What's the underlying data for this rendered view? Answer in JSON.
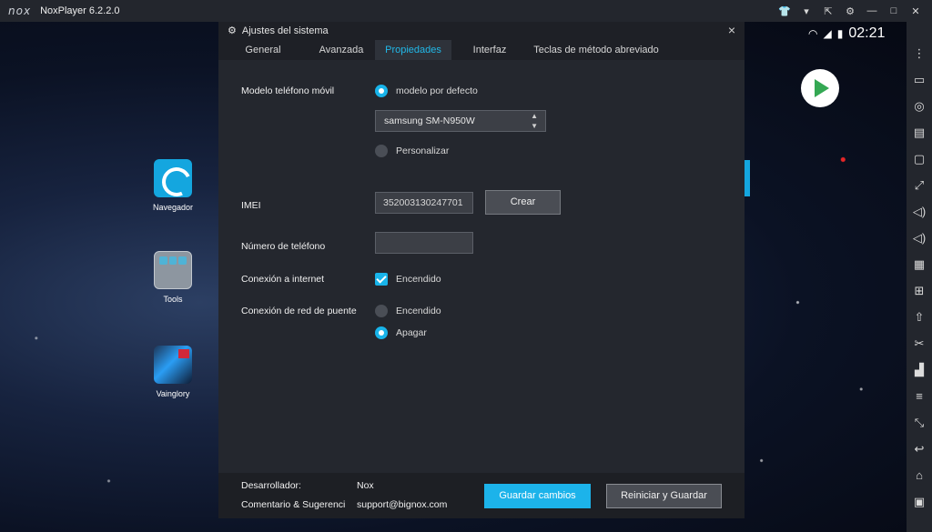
{
  "titlebar": {
    "logo": "nox",
    "title": "NoxPlayer 6.2.2.0",
    "buttons": [
      {
        "name": "shirt-icon",
        "glyph": "👕"
      },
      {
        "name": "menu-icon",
        "glyph": "▾"
      },
      {
        "name": "pin-icon",
        "glyph": "⇱"
      },
      {
        "name": "gear-icon",
        "glyph": "⚙"
      },
      {
        "name": "minimize-icon",
        "glyph": "—"
      },
      {
        "name": "maximize-icon",
        "glyph": "□"
      },
      {
        "name": "close-icon",
        "glyph": "✕"
      }
    ]
  },
  "desktop": {
    "icons": [
      {
        "label": "Navegador"
      },
      {
        "label": "Tools"
      },
      {
        "label": "Vainglory"
      }
    ],
    "status_time": "02:21"
  },
  "dialog": {
    "title": "Ajustes del sistema",
    "close_glyph": "×",
    "tabs": [
      {
        "label": "General"
      },
      {
        "label": "Avanzada"
      },
      {
        "label": "Propiedades"
      },
      {
        "label": "Interfaz"
      },
      {
        "label": "Teclas de método abreviado"
      }
    ],
    "active_tab": "Propiedades",
    "phone_model": {
      "label": "Modelo teléfono móvil",
      "option_default": "modelo por defecto",
      "selected": "samsung SM-N950W",
      "option_custom": "Personalizar"
    },
    "imei": {
      "label": "IMEI",
      "value": "352003130247701",
      "button": "Crear"
    },
    "phone_number": {
      "label": "Número de teléfono",
      "value": ""
    },
    "internet": {
      "label": "Conexión a internet",
      "option_on": "Encendido",
      "checked": true
    },
    "bridge": {
      "label": "Conexión de red de puente",
      "option_on": "Encendido",
      "option_off": "Apagar",
      "selected": "Apagar"
    },
    "footer": {
      "developer_label": "Desarrollador:",
      "developer_value": "Nox",
      "feedback_label": "Comentario & Sugerenci",
      "feedback_value": "support@bignox.com",
      "save_button": "Guardar cambios",
      "restart_button": "Reiniciar y Guardar"
    }
  },
  "rightbar": {
    "icons": [
      "⋮",
      "▭",
      "◎",
      "▤",
      "▢",
      "⤢",
      "◁)",
      "◁)",
      "▦",
      "⊞",
      "⇧",
      "✂",
      "▟",
      "≡",
      "⤡",
      "↩",
      "⌂",
      "▣"
    ]
  },
  "colors": {
    "accent": "#18b4ea",
    "dialog_bg": "#24272e",
    "titlebar_bg": "#23262d"
  }
}
